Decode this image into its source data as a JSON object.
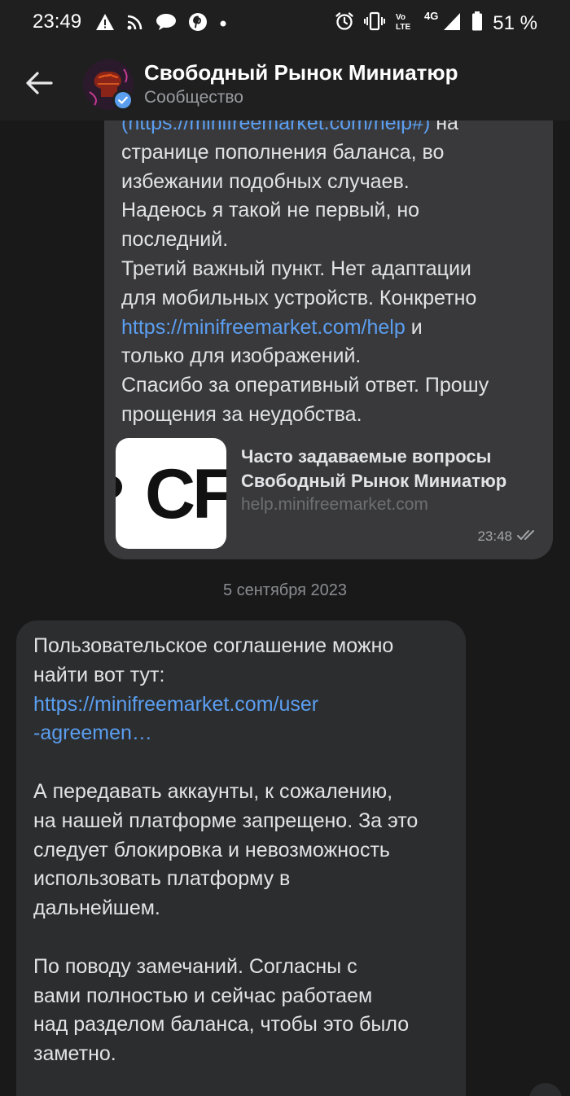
{
  "status_bar": {
    "time": "23:49",
    "left_icons": [
      "warning-icon",
      "cast-icon",
      "chat-bubble-icon",
      "pinterest-icon",
      "dot-icon"
    ],
    "right_icons": [
      "alarm-icon",
      "vibrate-icon",
      "volte-icon",
      "signal-4g-icon",
      "battery-icon"
    ],
    "network_label": "4G",
    "volte_label_top": "Vo",
    "volte_label_bottom": "LTE",
    "battery_percent": "51 %"
  },
  "header": {
    "title": "Свободный Рынок Миниатюр",
    "subtitle": "Сообщество",
    "verified": true
  },
  "messages": [
    {
      "direction": "outgoing",
      "lines": [
        {
          "parts": [
            {
              "text": "(https://minifreemarket.com/help#)",
              "link": true
            },
            {
              "text": " на",
              "link": false
            }
          ]
        },
        {
          "parts": [
            {
              "text": "странице пополнения баланса, во",
              "link": false
            }
          ]
        },
        {
          "parts": [
            {
              "text": "избежании подобных случаев.",
              "link": false
            }
          ]
        },
        {
          "parts": [
            {
              "text": "Надеюсь я такой не первый, но",
              "link": false
            }
          ]
        },
        {
          "parts": [
            {
              "text": "последний.",
              "link": false
            }
          ]
        },
        {
          "parts": [
            {
              "text": "Третий важный пункт. Нет адаптации",
              "link": false
            }
          ]
        },
        {
          "parts": [
            {
              "text": "для мобильных устройств. Конкретно",
              "link": false
            }
          ]
        },
        {
          "parts": [
            {
              "text": "https://minifreemarket.com/help",
              "link": true
            },
            {
              "text": " и",
              "link": false
            }
          ]
        },
        {
          "parts": [
            {
              "text": "только для изображений.",
              "link": false
            }
          ]
        },
        {
          "parts": [
            {
              "text": "Спасибо за оперативный ответ. Прошу",
              "link": false
            }
          ]
        },
        {
          "parts": [
            {
              "text": "прощения за неудобства.",
              "link": false
            }
          ]
        }
      ],
      "link_preview": {
        "title_line1": "Часто задаваемые вопросы",
        "title_line2": "Свободный Рынок Миниатюр",
        "domain": "help.minifreemarket.com",
        "thumb_text": "CF"
      },
      "time": "23:48",
      "read": true
    },
    {
      "direction": "incoming",
      "lines": [
        {
          "parts": [
            {
              "text": "Пользовательское соглашение можно",
              "link": false
            }
          ]
        },
        {
          "parts": [
            {
              "text": "найти вот тут:",
              "link": false
            }
          ]
        },
        {
          "parts": [
            {
              "text": "https://minifreemarket.com/user",
              "link": true
            }
          ]
        },
        {
          "parts": [
            {
              "text": "-agreemen…",
              "link": true
            }
          ]
        },
        {
          "parts": [
            {
              "text": "",
              "link": false
            }
          ]
        },
        {
          "parts": [
            {
              "text": "А передавать аккаунты, к сожалению,",
              "link": false
            }
          ]
        },
        {
          "parts": [
            {
              "text": "на нашей платформе запрещено. За это",
              "link": false
            }
          ]
        },
        {
          "parts": [
            {
              "text": "следует блокировка и невозможность",
              "link": false
            }
          ]
        },
        {
          "parts": [
            {
              "text": "использовать платформу в",
              "link": false
            }
          ]
        },
        {
          "parts": [
            {
              "text": "дальнейшем.",
              "link": false
            }
          ]
        },
        {
          "parts": [
            {
              "text": "",
              "link": false
            }
          ]
        },
        {
          "parts": [
            {
              "text": "По поводу замечаний. Согласны с",
              "link": false
            }
          ]
        },
        {
          "parts": [
            {
              "text": "вами полностью и сейчас работаем",
              "link": false
            }
          ]
        },
        {
          "parts": [
            {
              "text": "над разделом баланса, чтобы это было",
              "link": false
            }
          ]
        },
        {
          "parts": [
            {
              "text": "заметно.",
              "link": false
            }
          ]
        }
      ]
    }
  ],
  "date_separator": "5 сентября 2023",
  "colors": {
    "background": "#19191a",
    "outgoing_bubble": "#39393b",
    "incoming_bubble": "#2c2d2f",
    "link": "#5b9ef0",
    "verified_badge": "#5b9ef0"
  }
}
